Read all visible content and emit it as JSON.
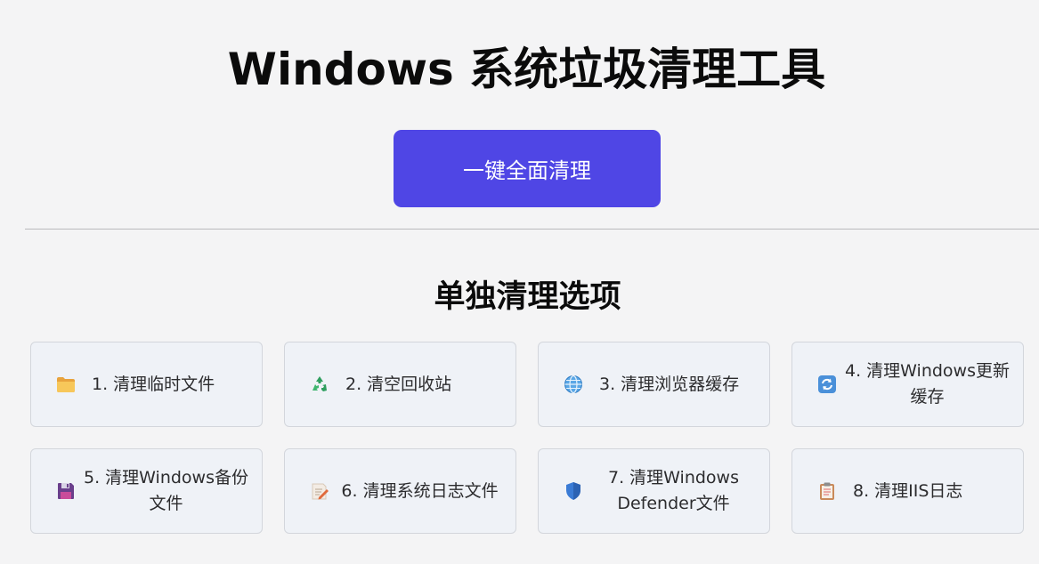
{
  "app": {
    "title": "Windows 系统垃圾清理工具"
  },
  "main_action": {
    "label": "一键全面清理",
    "color": "#4f46e5"
  },
  "section": {
    "title": "单独清理选项"
  },
  "options": [
    {
      "label": "1. 清理临时文件",
      "icon": "folder-icon"
    },
    {
      "label": "2. 清空回收站",
      "icon": "recycle-icon"
    },
    {
      "label": "3. 清理浏览器缓存",
      "icon": "globe-icon"
    },
    {
      "label": "4. 清理Windows更新缓存",
      "icon": "refresh-icon"
    },
    {
      "label": "5. 清理Windows备份文件",
      "icon": "floppy-disk-icon"
    },
    {
      "label": "6. 清理系统日志文件",
      "icon": "memo-icon"
    },
    {
      "label": "7. 清理Windows Defender文件",
      "icon": "shield-icon"
    },
    {
      "label": "8. 清理IIS日志",
      "icon": "clipboard-icon"
    }
  ]
}
